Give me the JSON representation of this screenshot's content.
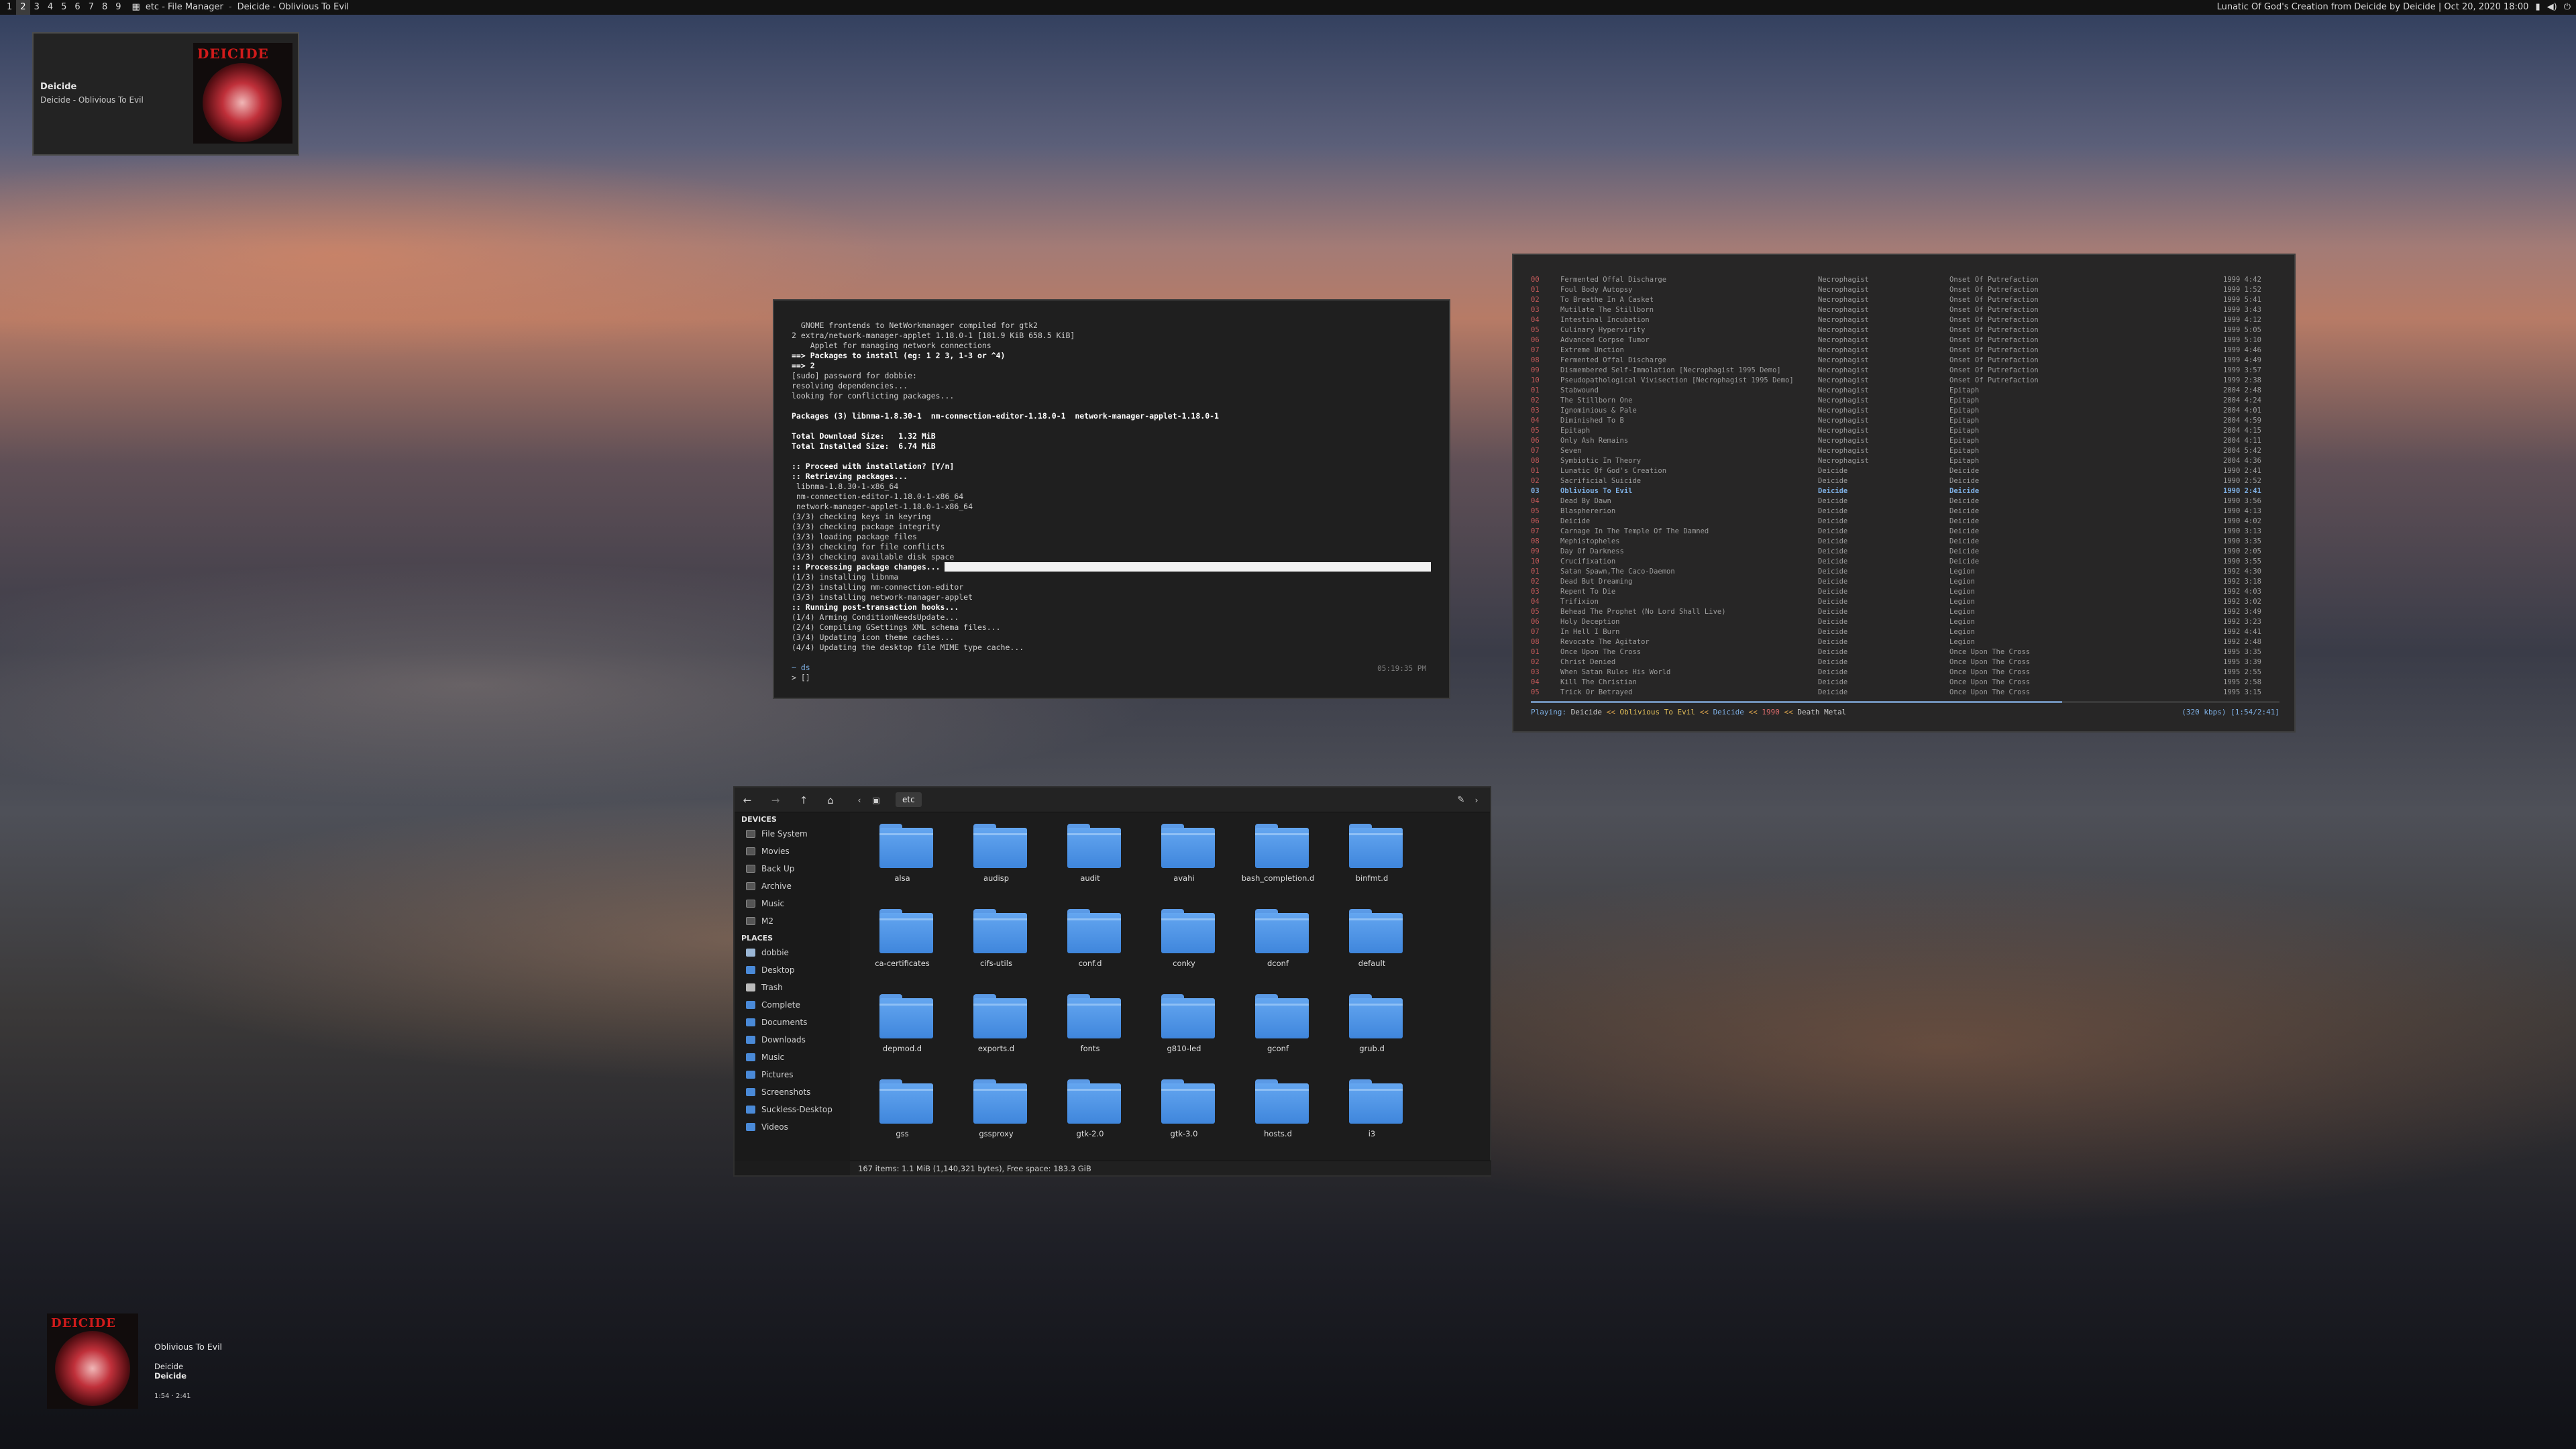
{
  "topbar": {
    "workspaces": [
      "1",
      "2",
      "3",
      "4",
      "5",
      "6",
      "7",
      "8",
      "9"
    ],
    "active_workspace_index": 1,
    "window_title_1": "etc - File Manager",
    "window_title_2": "Deicide - Oblivious To Evil",
    "status_text": "Lunatic Of God's Creation from Deicide by Deicide | Oct 20, 2020 18:00"
  },
  "notification": {
    "title": "Deicide",
    "body": "Deicide - Oblivious To Evil",
    "cover_logo": "DEICIDE"
  },
  "terminal": {
    "lines": [
      "  GNOME frontends to NetWorkmanager compiled for gtk2",
      "2 extra/network-manager-applet 1.18.0-1 [181.9 KiB 658.5 KiB]",
      "    Applet for managing network connections",
      "==> Packages to install (eg: 1 2 3, 1-3 or ^4)",
      "==> 2",
      "[sudo] password for dobbie:",
      "resolving dependencies...",
      "looking for conflicting packages...",
      "",
      "Packages (3) libnma-1.8.30-1  nm-connection-editor-1.18.0-1  network-manager-applet-1.18.0-1",
      "",
      "Total Download Size:   1.32 MiB",
      "Total Installed Size:  6.74 MiB",
      "",
      ":: Proceed with installation? [Y/n]",
      ":: Retrieving packages...",
      " libnma-1.8.30-1-x86_64",
      " nm-connection-editor-1.18.0-1-x86_64",
      " network-manager-applet-1.18.0-1-x86_64",
      "(3/3) checking keys in keyring",
      "(3/3) checking package integrity",
      "(3/3) loading package files",
      "(3/3) checking for file conflicts",
      "(3/3) checking available disk space",
      ":: Processing package changes...",
      "(1/3) installing libnma",
      "(2/3) installing nm-connection-editor",
      "(3/3) installing network-manager-applet",
      ":: Running post-transaction hooks...",
      "(1/4) Arming ConditionNeedsUpdate...",
      "(2/4) Compiling GSettings XML schema files...",
      "(3/4) Updating icon theme caches...",
      "(4/4) Updating the desktop file MIME type cache..."
    ],
    "prompt_dir": "~ ds",
    "prompt": "> []",
    "clock": "05:19:35 PM",
    "progress": 1.0
  },
  "music": {
    "tracks": [
      {
        "n": "00",
        "title": "Fermented Offal Discharge",
        "artist": "Necrophagist",
        "album": "Onset Of Putrefaction",
        "year": "1999 4:42"
      },
      {
        "n": "01",
        "title": "Foul Body Autopsy",
        "artist": "Necrophagist",
        "album": "Onset Of Putrefaction",
        "year": "1999 1:52"
      },
      {
        "n": "02",
        "title": "To Breathe In A Casket",
        "artist": "Necrophagist",
        "album": "Onset Of Putrefaction",
        "year": "1999 5:41"
      },
      {
        "n": "03",
        "title": "Mutilate The Stillborn",
        "artist": "Necrophagist",
        "album": "Onset Of Putrefaction",
        "year": "1999 3:43"
      },
      {
        "n": "04",
        "title": "Intestinal Incubation",
        "artist": "Necrophagist",
        "album": "Onset Of Putrefaction",
        "year": "1999 4:12"
      },
      {
        "n": "05",
        "title": "Culinary Hypervirity",
        "artist": "Necrophagist",
        "album": "Onset Of Putrefaction",
        "year": "1999 5:05"
      },
      {
        "n": "06",
        "title": "Advanced Corpse Tumor",
        "artist": "Necrophagist",
        "album": "Onset Of Putrefaction",
        "year": "1999 5:10"
      },
      {
        "n": "07",
        "title": "Extreme Unction",
        "artist": "Necrophagist",
        "album": "Onset Of Putrefaction",
        "year": "1999 4:46"
      },
      {
        "n": "08",
        "title": "Fermented Offal Discharge",
        "artist": "Necrophagist",
        "album": "Onset Of Putrefaction",
        "year": "1999 4:49"
      },
      {
        "n": "09",
        "title": "Dismembered Self-Immolation [Necrophagist 1995 Demo]",
        "artist": "Necrophagist",
        "album": "Onset Of Putrefaction",
        "year": "1999 3:57"
      },
      {
        "n": "10",
        "title": "Pseudopathological Vivisection [Necrophagist 1995 Demo]",
        "artist": "Necrophagist",
        "album": "Onset Of Putrefaction",
        "year": "1999 2:38"
      },
      {
        "n": "01",
        "title": "Stabwound",
        "artist": "Necrophagist",
        "album": "Epitaph",
        "year": "2004 2:48"
      },
      {
        "n": "02",
        "title": "The Stillborn One",
        "artist": "Necrophagist",
        "album": "Epitaph",
        "year": "2004 4:24"
      },
      {
        "n": "03",
        "title": "Ignominious & Pale",
        "artist": "Necrophagist",
        "album": "Epitaph",
        "year": "2004 4:01"
      },
      {
        "n": "04",
        "title": "Diminished To B",
        "artist": "Necrophagist",
        "album": "Epitaph",
        "year": "2004 4:59"
      },
      {
        "n": "05",
        "title": "Epitaph",
        "artist": "Necrophagist",
        "album": "Epitaph",
        "year": "2004 4:15"
      },
      {
        "n": "06",
        "title": "Only Ash Remains",
        "artist": "Necrophagist",
        "album": "Epitaph",
        "year": "2004 4:11"
      },
      {
        "n": "07",
        "title": "Seven",
        "artist": "Necrophagist",
        "album": "Epitaph",
        "year": "2004 5:42"
      },
      {
        "n": "08",
        "title": "Symbiotic In Theory",
        "artist": "Necrophagist",
        "album": "Epitaph",
        "year": "2004 4:36"
      },
      {
        "n": "01",
        "title": "Lunatic Of God's Creation",
        "artist": "Deicide",
        "album": "Deicide",
        "year": "1990 2:41"
      },
      {
        "n": "02",
        "title": "Sacrificial Suicide",
        "artist": "Deicide",
        "album": "Deicide",
        "year": "1990 2:52"
      },
      {
        "n": "03",
        "title": "Oblivious To Evil",
        "artist": "Deicide",
        "album": "Deicide",
        "year": "1990 2:41"
      },
      {
        "n": "04",
        "title": "Dead By Dawn",
        "artist": "Deicide",
        "album": "Deicide",
        "year": "1990 3:56"
      },
      {
        "n": "05",
        "title": "Blasphererion",
        "artist": "Deicide",
        "album": "Deicide",
        "year": "1990 4:13"
      },
      {
        "n": "06",
        "title": "Deicide",
        "artist": "Deicide",
        "album": "Deicide",
        "year": "1990 4:02"
      },
      {
        "n": "07",
        "title": "Carnage In The Temple Of The Damned",
        "artist": "Deicide",
        "album": "Deicide",
        "year": "1990 3:13"
      },
      {
        "n": "08",
        "title": "Mephistopheles",
        "artist": "Deicide",
        "album": "Deicide",
        "year": "1990 3:35"
      },
      {
        "n": "09",
        "title": "Day Of Darkness",
        "artist": "Deicide",
        "album": "Deicide",
        "year": "1990 2:05"
      },
      {
        "n": "10",
        "title": "Crucifixation",
        "artist": "Deicide",
        "album": "Deicide",
        "year": "1990 3:55"
      },
      {
        "n": "01",
        "title": "Satan Spawn,The Caco-Daemon",
        "artist": "Deicide",
        "album": "Legion",
        "year": "1992 4:30"
      },
      {
        "n": "02",
        "title": "Dead But Dreaming",
        "artist": "Deicide",
        "album": "Legion",
        "year": "1992 3:18"
      },
      {
        "n": "03",
        "title": "Repent To Die",
        "artist": "Deicide",
        "album": "Legion",
        "year": "1992 4:03"
      },
      {
        "n": "04",
        "title": "Trifixion",
        "artist": "Deicide",
        "album": "Legion",
        "year": "1992 3:02"
      },
      {
        "n": "05",
        "title": "Behead The Prophet (No Lord Shall Live)",
        "artist": "Deicide",
        "album": "Legion",
        "year": "1992 3:49"
      },
      {
        "n": "06",
        "title": "Holy Deception",
        "artist": "Deicide",
        "album": "Legion",
        "year": "1992 3:23"
      },
      {
        "n": "07",
        "title": "In Hell I Burn",
        "artist": "Deicide",
        "album": "Legion",
        "year": "1992 4:41"
      },
      {
        "n": "08",
        "title": "Revocate The Agitator",
        "artist": "Deicide",
        "album": "Legion",
        "year": "1992 2:48"
      },
      {
        "n": "01",
        "title": "Once Upon The Cross",
        "artist": "Deicide",
        "album": "Once Upon The Cross",
        "year": "1995 3:35"
      },
      {
        "n": "02",
        "title": "Christ Denied",
        "artist": "Deicide",
        "album": "Once Upon The Cross",
        "year": "1995 3:39"
      },
      {
        "n": "03",
        "title": "When Satan Rules His World",
        "artist": "Deicide",
        "album": "Once Upon The Cross",
        "year": "1995 2:55"
      },
      {
        "n": "04",
        "title": "Kill The Christian",
        "artist": "Deicide",
        "album": "Once Upon The Cross",
        "year": "1995 2:58"
      },
      {
        "n": "05",
        "title": "Trick Or Betrayed",
        "artist": "Deicide",
        "album": "Once Upon The Cross",
        "year": "1995 3:15"
      }
    ],
    "current_index": 21,
    "status": {
      "label": "Playing:",
      "artist": "Deicide",
      "sep1": "<<",
      "title": "Oblivious To Evil",
      "sep2": "<<",
      "album": "Deicide",
      "sep3": "<<",
      "year": "1990",
      "sep4": "<<",
      "genre": "Death Metal",
      "right": "(320 kbps) [1:54/2:41]"
    },
    "progress": 0.71
  },
  "file_manager": {
    "path_label": "etc",
    "devices_heading": "DEVICES",
    "devices": [
      "File System",
      "Movies",
      "Back Up",
      "Archive",
      "Music",
      "M2"
    ],
    "places_heading": "PLACES",
    "places": [
      "dobbie",
      "Desktop",
      "Trash",
      "Complete",
      "Documents",
      "Downloads",
      "Music",
      "Pictures",
      "Screenshots",
      "Suckless-Desktop",
      "Videos"
    ],
    "folders": [
      "alsa",
      "audisp",
      "audit",
      "avahi",
      "bash_completion.d",
      "binfmt.d",
      "ca-certificates",
      "cifs-utils",
      "conf.d",
      "conky",
      "dconf",
      "default",
      "depmod.d",
      "exports.d",
      "fonts",
      "g810-led",
      "gconf",
      "grub.d",
      "gss",
      "gssproxy",
      "gtk-2.0",
      "gtk-3.0",
      "hosts.d",
      "i3"
    ],
    "status": "167 items: 1.1 MiB (1,140,321 bytes), Free space: 183.3 GiB"
  },
  "now_playing": {
    "title": "Oblivious To Evil",
    "artist": "Deicide",
    "album": "Deicide",
    "time": "1:54 · 2:41",
    "cover_logo": "DEICIDE"
  }
}
